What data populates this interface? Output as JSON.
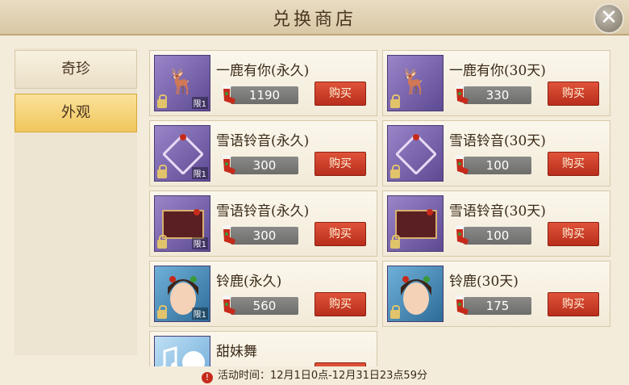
{
  "header": {
    "title": "兑换商店",
    "close_label": "✕"
  },
  "sidebar": {
    "tabs": [
      {
        "label": "奇珍",
        "active": false
      },
      {
        "label": "外观",
        "active": true
      }
    ]
  },
  "currency": {
    "icon": "stocking-icon"
  },
  "items": [
    {
      "name": "一鹿有你(永久)",
      "price": "1190",
      "buy_label": "购买",
      "limit": "限1",
      "locked": true,
      "art": "antlers"
    },
    {
      "name": "一鹿有你(30天)",
      "price": "330",
      "buy_label": "购买",
      "limit": "",
      "locked": true,
      "art": "antlers"
    },
    {
      "name": "雪语铃音(永久)",
      "price": "300",
      "buy_label": "购买",
      "limit": "限1",
      "locked": true,
      "art": "frame"
    },
    {
      "name": "雪语铃音(30天)",
      "price": "100",
      "buy_label": "购买",
      "limit": "",
      "locked": true,
      "art": "frame"
    },
    {
      "name": "雪语铃音(永久)",
      "price": "300",
      "buy_label": "购买",
      "limit": "限1",
      "locked": true,
      "art": "board"
    },
    {
      "name": "雪语铃音(30天)",
      "price": "100",
      "buy_label": "购买",
      "limit": "",
      "locked": true,
      "art": "board"
    },
    {
      "name": "铃鹿(永久)",
      "price": "560",
      "buy_label": "购买",
      "limit": "限1",
      "locked": true,
      "art": "avatar"
    },
    {
      "name": "铃鹿(30天)",
      "price": "175",
      "buy_label": "购买",
      "limit": "",
      "locked": true,
      "art": "avatar"
    },
    {
      "name": "甜妹舞",
      "price": "",
      "buy_label": "",
      "limit": "",
      "locked": false,
      "art": "dance"
    }
  ],
  "footer": {
    "warn_icon": "!",
    "text": "活动时间：12月1日0点-12月31日23点59分"
  },
  "colors": {
    "accent": "#f0c65c",
    "buy_button": "#c8381f",
    "price_bar": "#7a7a78"
  }
}
